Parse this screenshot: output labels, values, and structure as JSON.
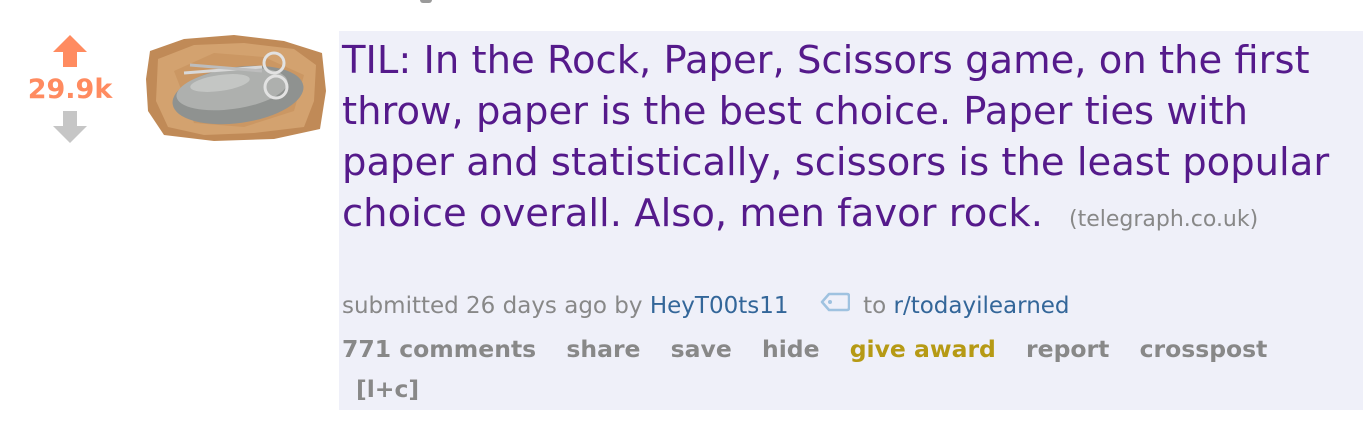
{
  "post": {
    "score": "29.9k",
    "title": "TIL: In the Rock, Paper, Scissors game, on the first throw, paper is the best choice. Paper ties with paper and statistically, scissors is the least popular choice overall. Also, men favor rock.",
    "domain": "(telegraph.co.uk)",
    "tagline": {
      "submitted": "submitted 26 days ago by",
      "author": "HeyT00ts11",
      "to": "to",
      "subreddit": "r/todayilearned"
    },
    "buttons": {
      "comments": "771 comments",
      "share": "share",
      "save": "save",
      "hide": "hide",
      "give_award": "give award",
      "report": "report",
      "crosspost": "crosspost",
      "lc": "[l+c]"
    }
  },
  "icons": {
    "upvote": "upvote-arrow-icon",
    "downvote": "downvote-arrow-icon",
    "crosspost": "crosspost-tag-icon"
  },
  "colors": {
    "score": "#ff8b60",
    "upvote": "#ff8b60",
    "downvote": "#c6c6c6",
    "title": "#551a8b",
    "link": "#336699",
    "meta": "#888888",
    "award": "#b69a15",
    "entry_bg": "#eff0f9"
  }
}
